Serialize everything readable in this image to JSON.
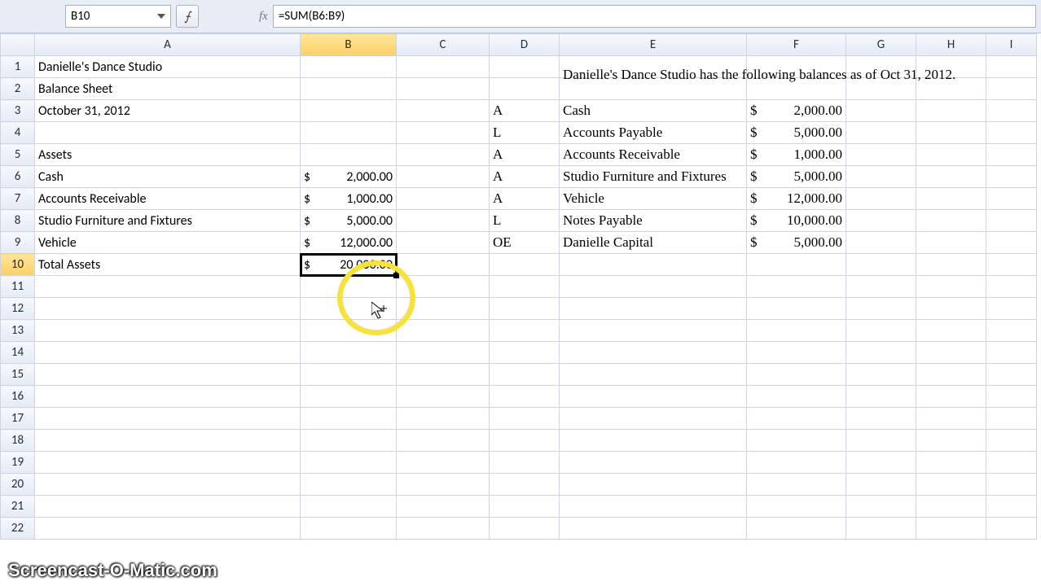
{
  "namebox": "B10",
  "fx_label": "fx",
  "formula": "=SUM(B6:B9)",
  "columns": [
    "A",
    "B",
    "C",
    "D",
    "E",
    "F",
    "G",
    "H",
    "I"
  ],
  "active_col": "B",
  "active_row": 10,
  "row_count": 22,
  "cells": {
    "A1": "Danielle's Dance Studio",
    "A2": "Balance Sheet",
    "A3": "October 31, 2012",
    "A5": "Assets",
    "A6": "Cash",
    "A7": "Accounts Receivable",
    "A8": "Studio Furniture and Fixtures",
    "A9": "Vehicle",
    "A10": "Total Assets",
    "B6": "2,000.00",
    "B7": "1,000.00",
    "B8": "5,000.00",
    "B9": "12,000.00",
    "B10": "20,000.00",
    "D3": "A",
    "D4": "L",
    "D5": "A",
    "D6": "A",
    "D7": "A",
    "D8": "L",
    "D9": "OE",
    "E1": "Danielle's Dance Studio has the following balances as of Oct 31, 2012.",
    "E3": "Cash",
    "E4": "Accounts Payable",
    "E5": "Accounts Receivable",
    "E6": "Studio Furniture and Fixtures",
    "E7": "Vehicle",
    "E8": "Notes Payable",
    "E9": "Danielle Capital",
    "F3": "2,000.00",
    "F4": "5,000.00",
    "F5": "1,000.00",
    "F6": "5,000.00",
    "F7": "12,000.00",
    "F8": "10,000.00",
    "F9": "5,000.00"
  },
  "currency_symbol": "$",
  "watermark": "Screencast-O-Matic.com"
}
